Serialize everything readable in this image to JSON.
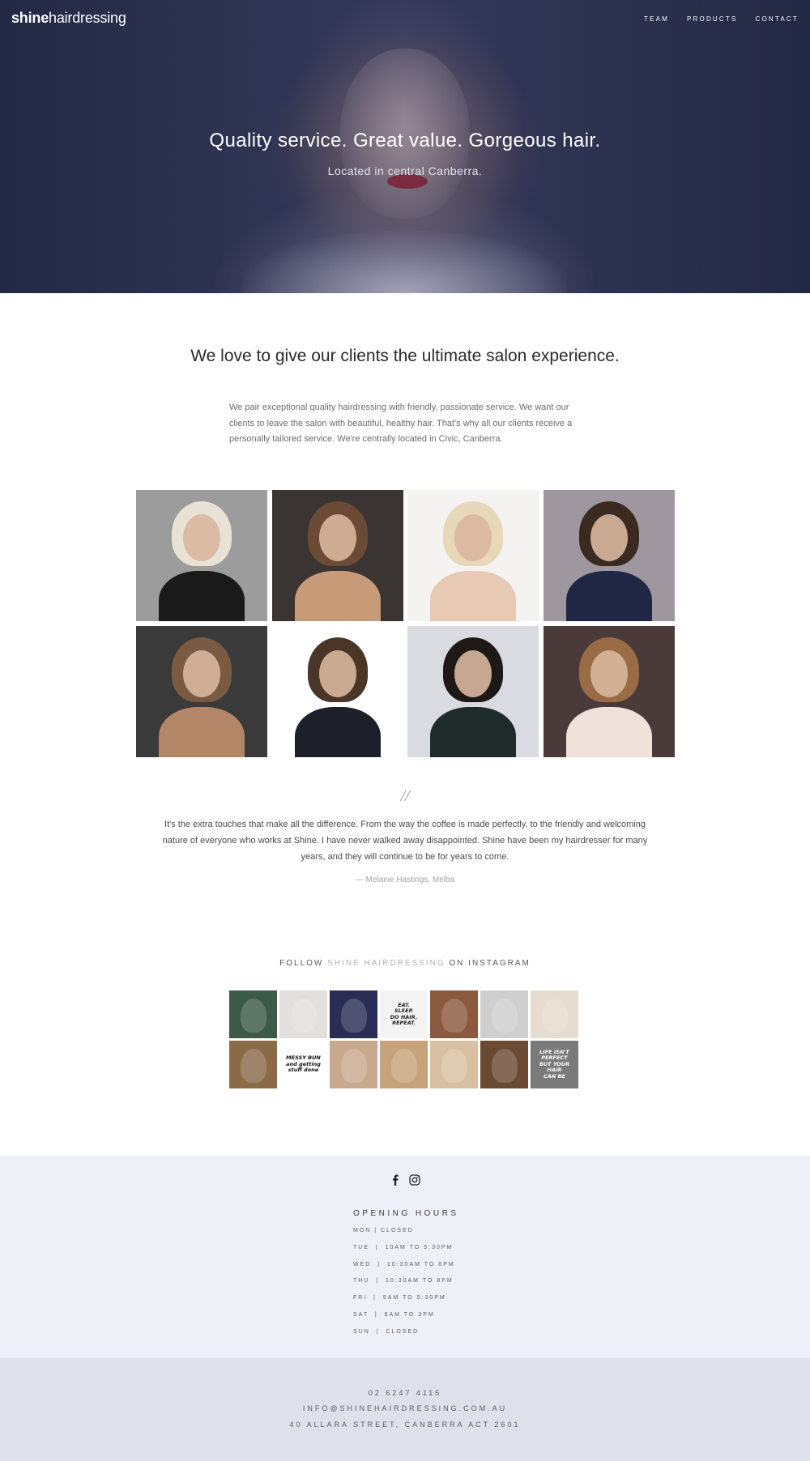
{
  "header": {
    "logo_bold": "shine",
    "logo_light": "hairdressing",
    "nav": [
      {
        "label": "TEAM"
      },
      {
        "label": "PRODUCTS"
      },
      {
        "label": "CONTACT"
      }
    ]
  },
  "hero": {
    "title": "Quality service. Great value. Gorgeous hair.",
    "subtitle": "Located in central Canberra."
  },
  "intro": {
    "heading": "We love to give our clients the ultimate salon experience.",
    "text": "We pair exceptional quality hairdressing with friendly, passionate service. We want our clients to leave the salon with beautiful, healthy hair. That's why all our clients receive a personally tailored service. We're centrally located in Civic, Canberra."
  },
  "gallery": [
    {
      "bg": "#9c9c9c",
      "fig": "#1a1a1a",
      "hair": "#e8e2d6"
    },
    {
      "bg": "#3a3533",
      "fig": "#c79a78",
      "hair": "#6b4a36"
    },
    {
      "bg": "#f4f3f2",
      "fig": "#e7c9b4",
      "hair": "#e6d8b8"
    },
    {
      "bg": "#9e97a0",
      "fig": "#202744",
      "hair": "#3a2a20"
    },
    {
      "bg": "#3a3a3a",
      "fig": "#b28666",
      "hair": "#7a5a42"
    },
    {
      "bg": "#ffffff",
      "fig": "#1d1f2b",
      "hair": "#4a3526"
    },
    {
      "bg": "#d9dbe1",
      "fig": "#1f2a2a",
      "hair": "#1e1916"
    },
    {
      "bg": "#4a3a3a",
      "fig": "#f0e2da",
      "hair": "#9a6c46"
    }
  ],
  "testimonial": {
    "mark": "//",
    "text": "It's the extra touches that make all the difference. From the way the coffee is made perfectly, to the friendly and welcoming nature of everyone who works at Shine. I have never walked away disappointed. Shine have been my hairdresser for many years, and they will continue to be for years to come.",
    "author": "— Melanie Hastings, Melba"
  },
  "instagram": {
    "title_pre": "FOLLOW ",
    "title_accent": "SHINE HAIRDRESSING",
    "title_post": " ON INSTAGRAM",
    "tiles": [
      {
        "bg": "#3c5a48",
        "text": ""
      },
      {
        "bg": "#e3dfdc",
        "text": ""
      },
      {
        "bg": "#2a2d55",
        "text": ""
      },
      {
        "bg": "#f4f4f4",
        "text": "EAT.\nSLEEP.\nDO HAIR.\nREPEAT.",
        "color": "#222222"
      },
      {
        "bg": "#8a5a3e",
        "text": ""
      },
      {
        "bg": "#cfcfcf",
        "text": ""
      },
      {
        "bg": "#e6dccf",
        "text": ""
      },
      {
        "bg": "#8b6a48",
        "text": ""
      },
      {
        "bg": "#ffffff",
        "text": "MESSY BUN\nand getting\nstuff done",
        "color": "#111111"
      },
      {
        "bg": "#c9a98e",
        "text": ""
      },
      {
        "bg": "#c7a37b",
        "text": ""
      },
      {
        "bg": "#d8c0a2",
        "text": ""
      },
      {
        "bg": "#6a4a32",
        "text": ""
      },
      {
        "bg": "#7a7a7a",
        "text": "LIFE ISN'T\nPERFECT\nBUT YOUR\nHAIR\nCAN BE",
        "color": "#ffffff"
      }
    ]
  },
  "hours": {
    "social": [
      {
        "name": "facebook-icon",
        "glyph": "f"
      },
      {
        "name": "instagram-icon",
        "glyph": ""
      }
    ],
    "title": "OPENING HOURS",
    "rows": [
      "MON | CLOSED",
      "TUE  |  10AM TO 5:30PM",
      "WED  |  10:30AM TO 8PM",
      "THU  |  10:30AM TO 8PM",
      "FRI  |  9AM TO 5:30PM",
      "SAT  |  8AM TO 3PM",
      "SUN  |  CLOSED"
    ]
  },
  "contact": {
    "phone": "02 6247 4115",
    "email": "INFO@SHINEHAIRDRESSING.COM.AU",
    "address": "40 ALLARA STREET, CANBERRA ACT 2601"
  },
  "colors": {
    "hero_bg": "#2d3250",
    "hours_bg": "#edf0f6",
    "contact_bg": "#dee1ea",
    "accent_text": "#b1b1b1"
  }
}
